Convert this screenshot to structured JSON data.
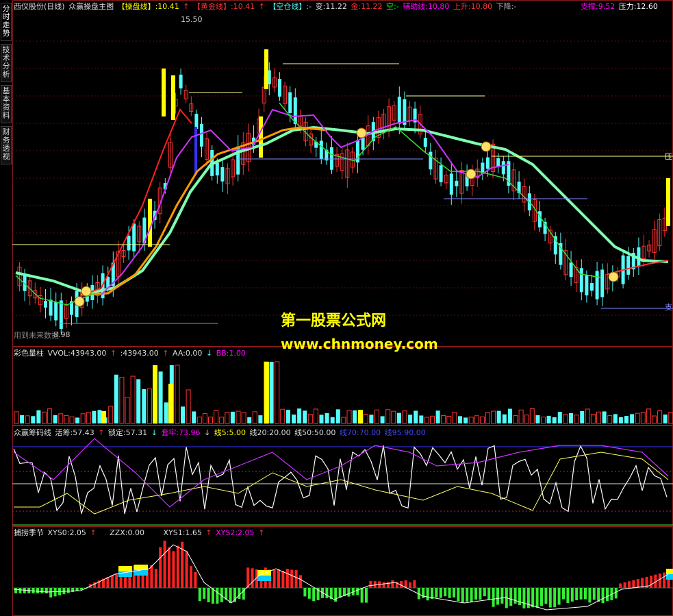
{
  "sidebar": {
    "tabs": [
      {
        "label": "分时走势"
      },
      {
        "label": "技术分析"
      },
      {
        "label": "基本资料"
      },
      {
        "label": "财务透视"
      }
    ]
  },
  "main": {
    "stock": "西仪股份(日线)",
    "indicator": "众赢操盘主图",
    "caopan": "【操盘线】:10.41",
    "huangjin": "【黄金线】:10.41",
    "kongcang": "【空仓线】:-",
    "bian": "变:11.22",
    "jin": "金:11.22",
    "kong": "空:-",
    "fuzhu": "辅助线:10.80",
    "shangsheng": "上升:10.80",
    "xiajiang": "下降:-",
    "zhicheng": "支撑:9.52",
    "yali": "压力:12.60",
    "high_label": "15.50",
    "low_label": "8.98",
    "right_label_ya": "压",
    "right_label_zhi": "支",
    "bottom_note": "用到未来数据"
  },
  "volume": {
    "name": "彩色量柱",
    "vvol": "VVOL:43943.00",
    "v2": ":43943.00",
    "aa": "AA:0.00",
    "bb": "BB:1.00"
  },
  "chouma": {
    "name": "众赢筹码线",
    "huochou": "活筹:57.43",
    "suoding": "锁定:57.31",
    "taolao": "套牢:73.96",
    "x5": "线5:5.00",
    "x20": "线20:20.00",
    "x50": "线50:50.00",
    "x70": "线70:70.00",
    "x95": "线95:90.00"
  },
  "bulao": {
    "name": "捕捞季节",
    "xys0": "XYS0:2.05",
    "zzx": "ZZX:0.00",
    "xys1": "XYS1:1.65",
    "xys2": "XYS2:2.05"
  },
  "watermark": {
    "title": "第一股票公式网",
    "url": "www.chnmoney.com"
  },
  "colors": {
    "up": "#ff3333",
    "down": "#54fcfc",
    "yellow": "#ffff00",
    "magenta": "#ff00ff",
    "green": "#00ff00"
  }
}
